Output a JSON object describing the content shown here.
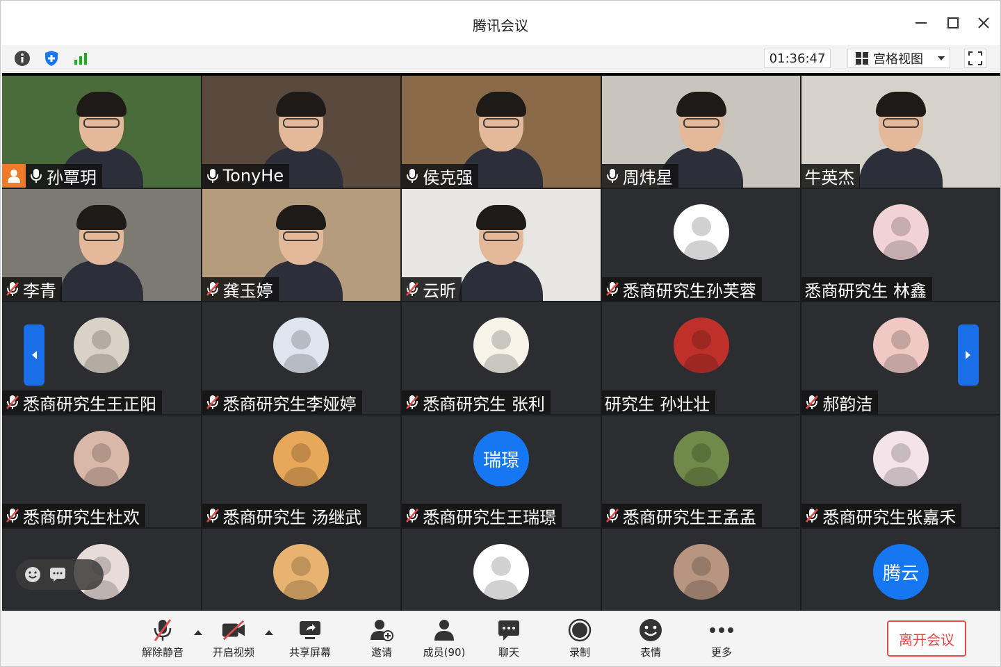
{
  "window": {
    "title": "腾讯会议"
  },
  "toolbar": {
    "timer": "01:36:47",
    "view_label": "宫格视图"
  },
  "tiles": [
    {
      "name": "孙覃玥",
      "type": "video",
      "mic": "on",
      "host": true,
      "bg": "#4a6b3a"
    },
    {
      "name": "TonyHe",
      "type": "video",
      "mic": "on",
      "bg": "#5a4a3e"
    },
    {
      "name": "侯克强",
      "type": "video",
      "mic": "on",
      "bg": "#8a6a48"
    },
    {
      "name": "周炜星",
      "type": "video",
      "mic": "on",
      "bg": "#c9c5bd"
    },
    {
      "name": "牛英杰",
      "type": "video",
      "mic": "none",
      "bg": "#d6d2ca"
    },
    {
      "name": "李青",
      "type": "video",
      "mic": "muted",
      "bg": "#7d7a73"
    },
    {
      "name": "龚玉婷",
      "type": "video",
      "mic": "muted",
      "bg": "#b59c7d"
    },
    {
      "name": "云昕",
      "type": "video",
      "mic": "muted",
      "bg": "#e8e6e2"
    },
    {
      "name": "悉商研究生孙芙蓉",
      "type": "avatar",
      "mic": "muted",
      "avatar_color": "#ffffff"
    },
    {
      "name": "悉商研究生 林鑫",
      "type": "avatar",
      "mic": "none",
      "avatar_color": "#f1d3d6"
    },
    {
      "name": "悉商研究生王正阳",
      "type": "avatar",
      "mic": "muted",
      "avatar_color": "#d9d2c6"
    },
    {
      "name": "悉商研究生李娅婷",
      "type": "avatar",
      "mic": "muted",
      "avatar_color": "#dfe5ef"
    },
    {
      "name": "悉商研究生 张利",
      "type": "avatar",
      "mic": "muted",
      "avatar_color": "#f7f3e8"
    },
    {
      "name": "研究生 孙壮壮",
      "type": "avatar",
      "mic": "none",
      "avatar_color": "#c0302b"
    },
    {
      "name": "郝韵洁",
      "type": "avatar",
      "mic": "muted",
      "avatar_color": "#f0c9c4"
    },
    {
      "name": "悉商研究生杜欢",
      "type": "avatar",
      "mic": "muted",
      "avatar_color": "#d9b8a8"
    },
    {
      "name": "悉商研究生 汤继武",
      "type": "avatar",
      "mic": "muted",
      "avatar_color": "#e8a85a"
    },
    {
      "name": "悉商研究生王瑞璟",
      "type": "avatar",
      "mic": "muted",
      "avatar_color": "#1577f2",
      "avatar_text": "瑞璟"
    },
    {
      "name": "悉商研究生王孟孟",
      "type": "avatar",
      "mic": "muted",
      "avatar_color": "#6f8a4a"
    },
    {
      "name": "悉商研究生张嘉禾",
      "type": "avatar",
      "mic": "muted",
      "avatar_color": "#f4e4ea"
    },
    {
      "name": "",
      "type": "avatar",
      "mic": "none",
      "avatar_color": "#e7dcd8"
    },
    {
      "name": "",
      "type": "avatar",
      "mic": "none",
      "avatar_color": "#e8b270"
    },
    {
      "name": "",
      "type": "avatar",
      "mic": "none",
      "avatar_color": "#ffffff"
    },
    {
      "name": "",
      "type": "avatar",
      "mic": "none",
      "avatar_color": "#b89580"
    },
    {
      "name": "",
      "type": "avatar",
      "mic": "none",
      "avatar_color": "#1577f2",
      "avatar_text": "腾云"
    }
  ],
  "controls": {
    "unmute": "解除静音",
    "start_video": "开启视频",
    "share_screen": "共享屏幕",
    "invite": "邀请",
    "members": "成员(90)",
    "chat": "聊天",
    "record": "录制",
    "reactions": "表情",
    "more": "更多",
    "leave": "离开会议"
  },
  "colors": {
    "accent": "#1577f2",
    "danger": "#e34b4b",
    "host": "#f07a2a",
    "grid_bg": "#2b2d31"
  }
}
